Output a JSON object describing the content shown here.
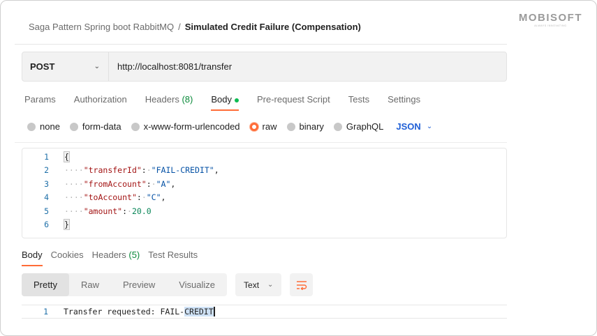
{
  "brand": {
    "logo_text": "MOBISOFT",
    "tagline": "ALWAYS INNOVATING"
  },
  "breadcrumb": {
    "collection": "Saga Pattern Spring boot RabbitMQ",
    "separator": "/",
    "request": "Simulated Credit Failure (Compensation)"
  },
  "request": {
    "method": "POST",
    "url": "http://localhost:8081/transfer"
  },
  "request_tabs": [
    {
      "label": "Params"
    },
    {
      "label": "Authorization"
    },
    {
      "label": "Headers",
      "count": "(8)"
    },
    {
      "label": "Body",
      "active": true
    },
    {
      "label": "Pre-request Script"
    },
    {
      "label": "Tests"
    },
    {
      "label": "Settings"
    }
  ],
  "body_modes": [
    "none",
    "form-data",
    "x-www-form-urlencoded",
    "raw",
    "binary",
    "GraphQL"
  ],
  "selected_body_mode": "raw",
  "body_format": "JSON",
  "editor": {
    "line_numbers": [
      "1",
      "2",
      "3",
      "4",
      "5",
      "6"
    ],
    "open_brace": "{",
    "close_brace": "}",
    "fields": [
      {
        "key": "\"transferId\"",
        "value": "\"FAIL-CREDIT\"",
        "trail": ","
      },
      {
        "key": "\"fromAccount\"",
        "value": "\"A\"",
        "trail": ","
      },
      {
        "key": "\"toAccount\"",
        "value": "\"C\"",
        "trail": ","
      },
      {
        "key": "\"amount\"",
        "value": "20.0",
        "trail": ""
      }
    ]
  },
  "response_tabs": [
    {
      "label": "Body",
      "active": true
    },
    {
      "label": "Cookies"
    },
    {
      "label": "Headers",
      "count": "(5)"
    },
    {
      "label": "Test Results"
    }
  ],
  "response_views": [
    "Pretty",
    "Raw",
    "Preview",
    "Visualize"
  ],
  "response_format": "Text",
  "response": {
    "line_number": "1",
    "text_prefix": "Transfer requested: FAIL-",
    "text_selected": "CREDIT"
  },
  "colors": {
    "accent": "#ff6c37",
    "success": "#0cbb52",
    "link": "#1f5fd6"
  }
}
